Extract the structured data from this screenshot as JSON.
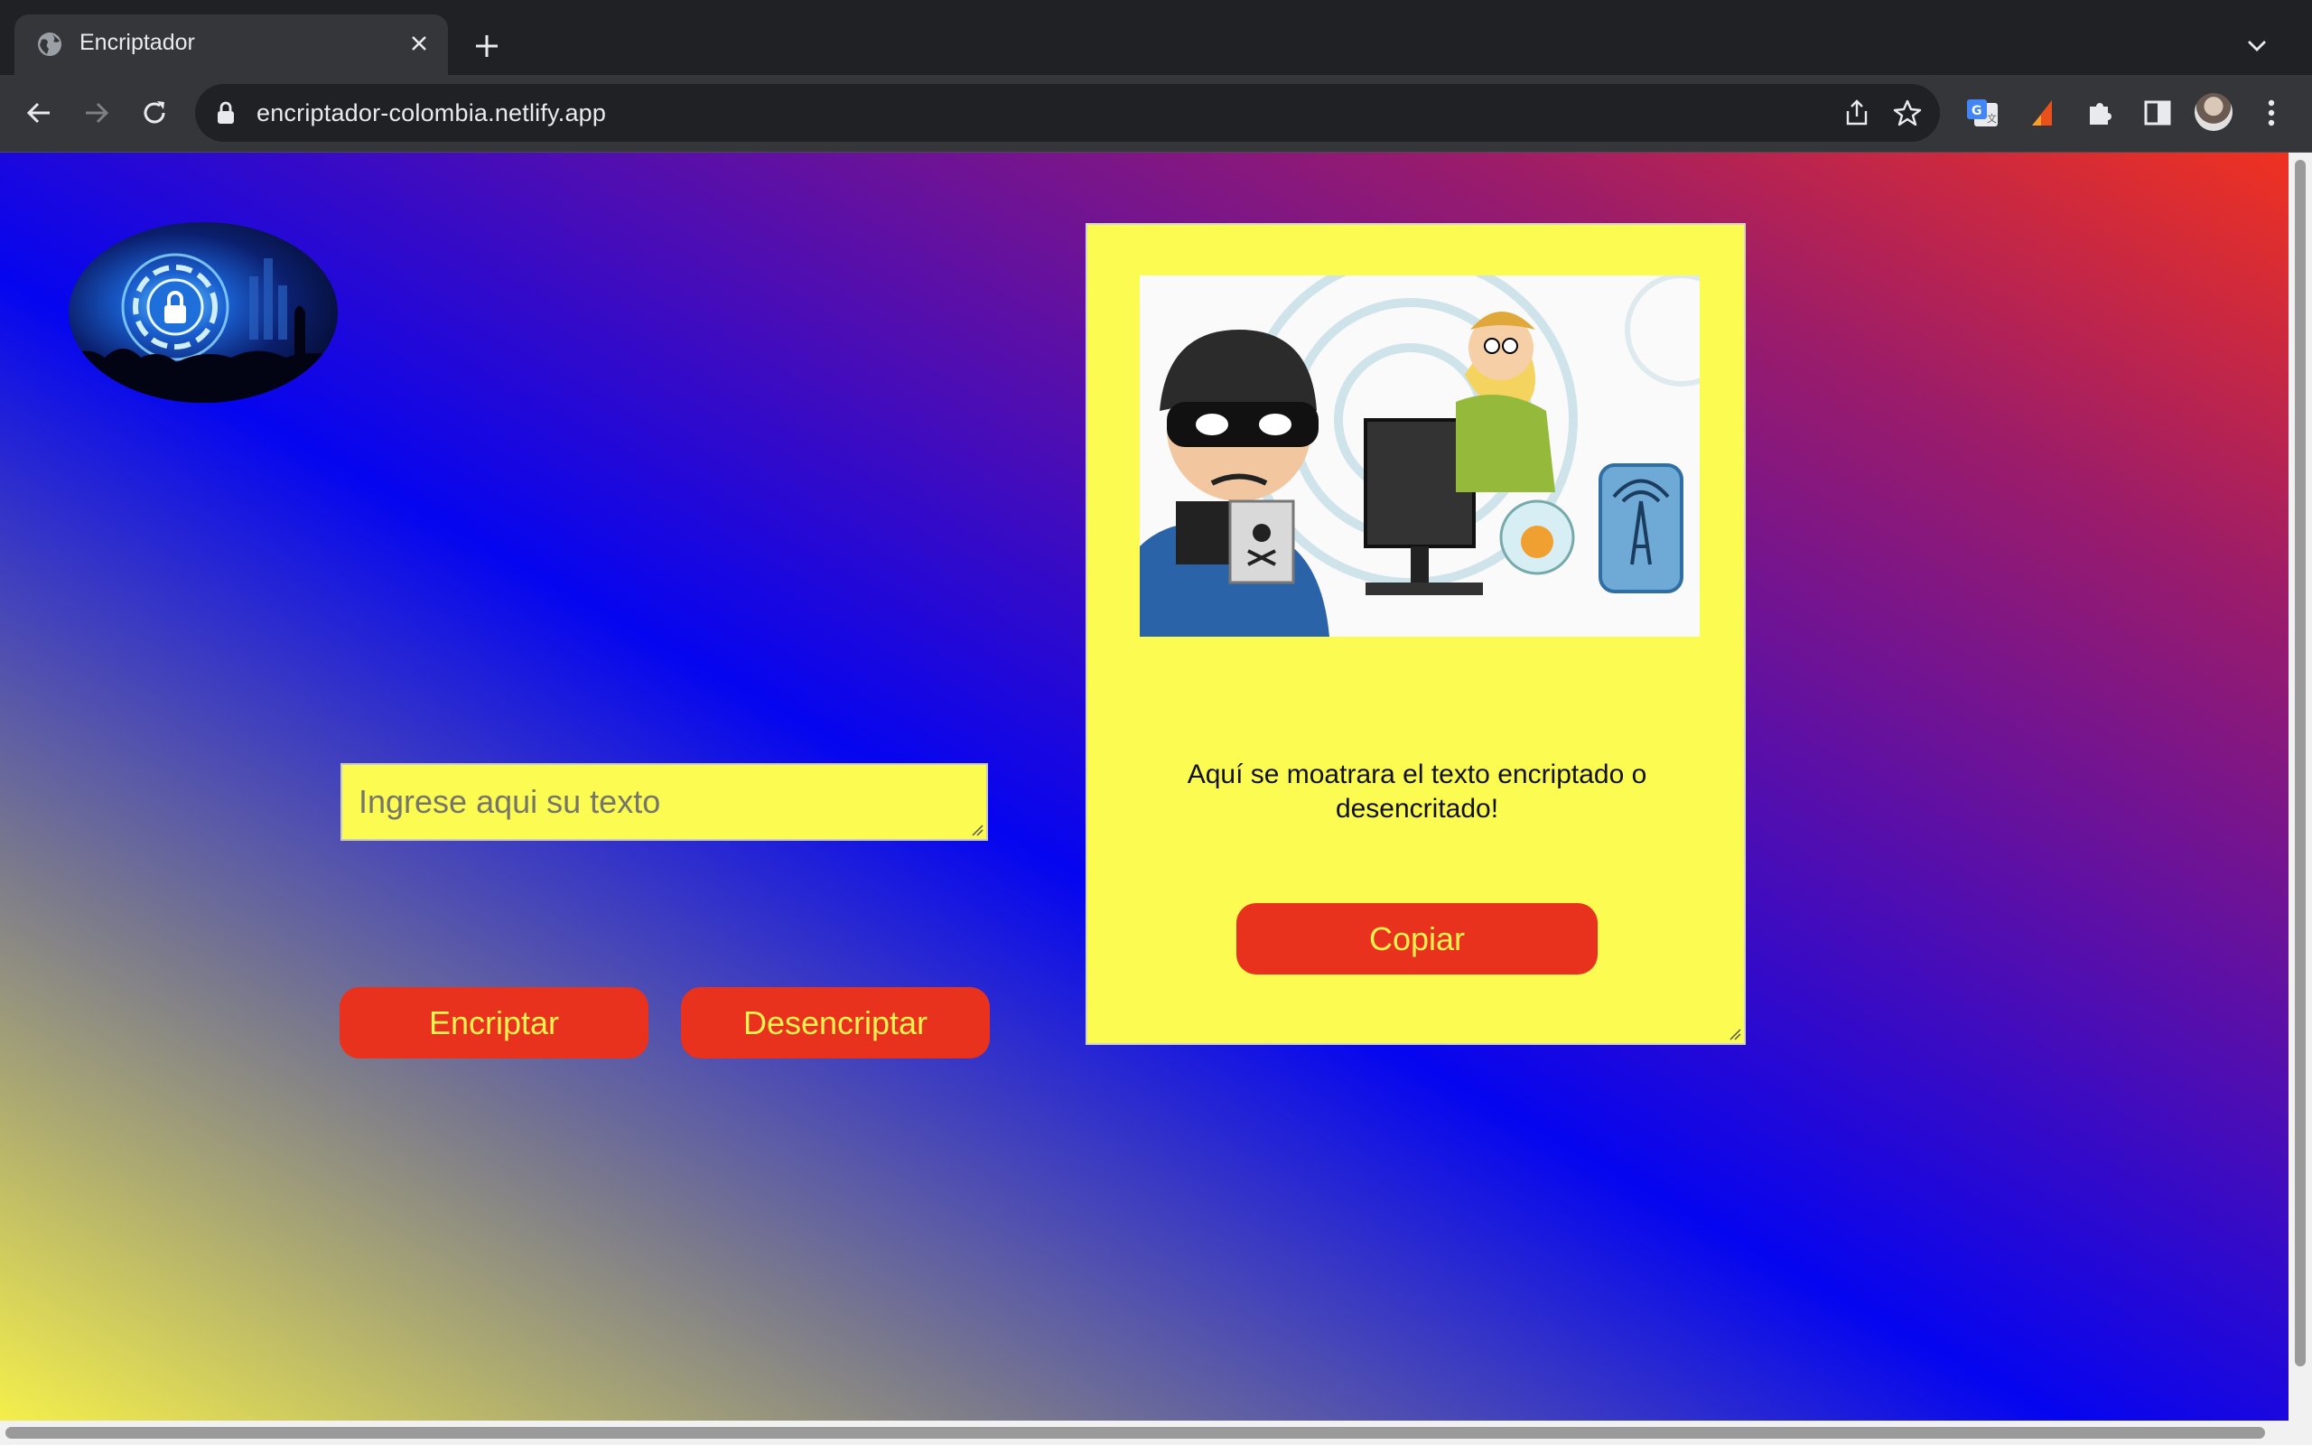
{
  "browser": {
    "tab_title": "Encriptador",
    "url": "encriptador-colombia.netlify.app"
  },
  "page": {
    "input_placeholder": "Ingrese aqui su texto",
    "encrypt_label": "Encriptar",
    "decrypt_label": "Desencriptar",
    "output_message": "Aquí se moatrara el texto encriptado o desencritado!",
    "copy_label": "Copiar"
  },
  "colors": {
    "button_bg": "#e8321e",
    "button_text": "#fbf14f",
    "panel_bg": "#fbfb52"
  }
}
